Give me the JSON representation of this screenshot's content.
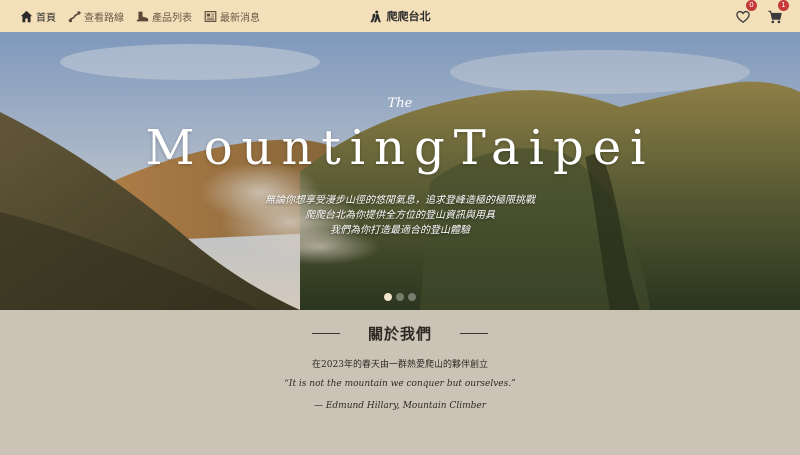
{
  "nav": {
    "items": [
      {
        "label": "首頁",
        "icon": "home-icon",
        "active": true
      },
      {
        "label": "查看路線",
        "icon": "route-icon",
        "active": false
      },
      {
        "label": "產品列表",
        "icon": "boot-icon",
        "active": false
      },
      {
        "label": "最新消息",
        "icon": "newspaper-icon",
        "active": false
      }
    ],
    "brand": "爬爬台北",
    "brand_icon": "mountaineer-icon",
    "wishlist_count": "0",
    "cart_count": "1"
  },
  "hero": {
    "small": "The",
    "title": "MountingTaipei",
    "lines": [
      "無論你想享受漫步山徑的悠閒氣息，追求登峰造極的極限挑戰",
      "爬爬台北為你提供全方位的登山資訊與用具",
      "我們為你打造最適合的登山體驗"
    ],
    "slides": 3,
    "active_slide": 0
  },
  "about": {
    "title": "關於我們",
    "text": "在2023年的春天由一群熱愛爬山的夥伴創立",
    "quote": "“It is not the mountain we conquer but ourselves.”",
    "author": "— Edmund Hillary, Mountain Climber"
  },
  "colors": {
    "nav_bg": "#f3dfb9",
    "about_bg": "#cbc3b5",
    "badge": "#c63a3a"
  }
}
